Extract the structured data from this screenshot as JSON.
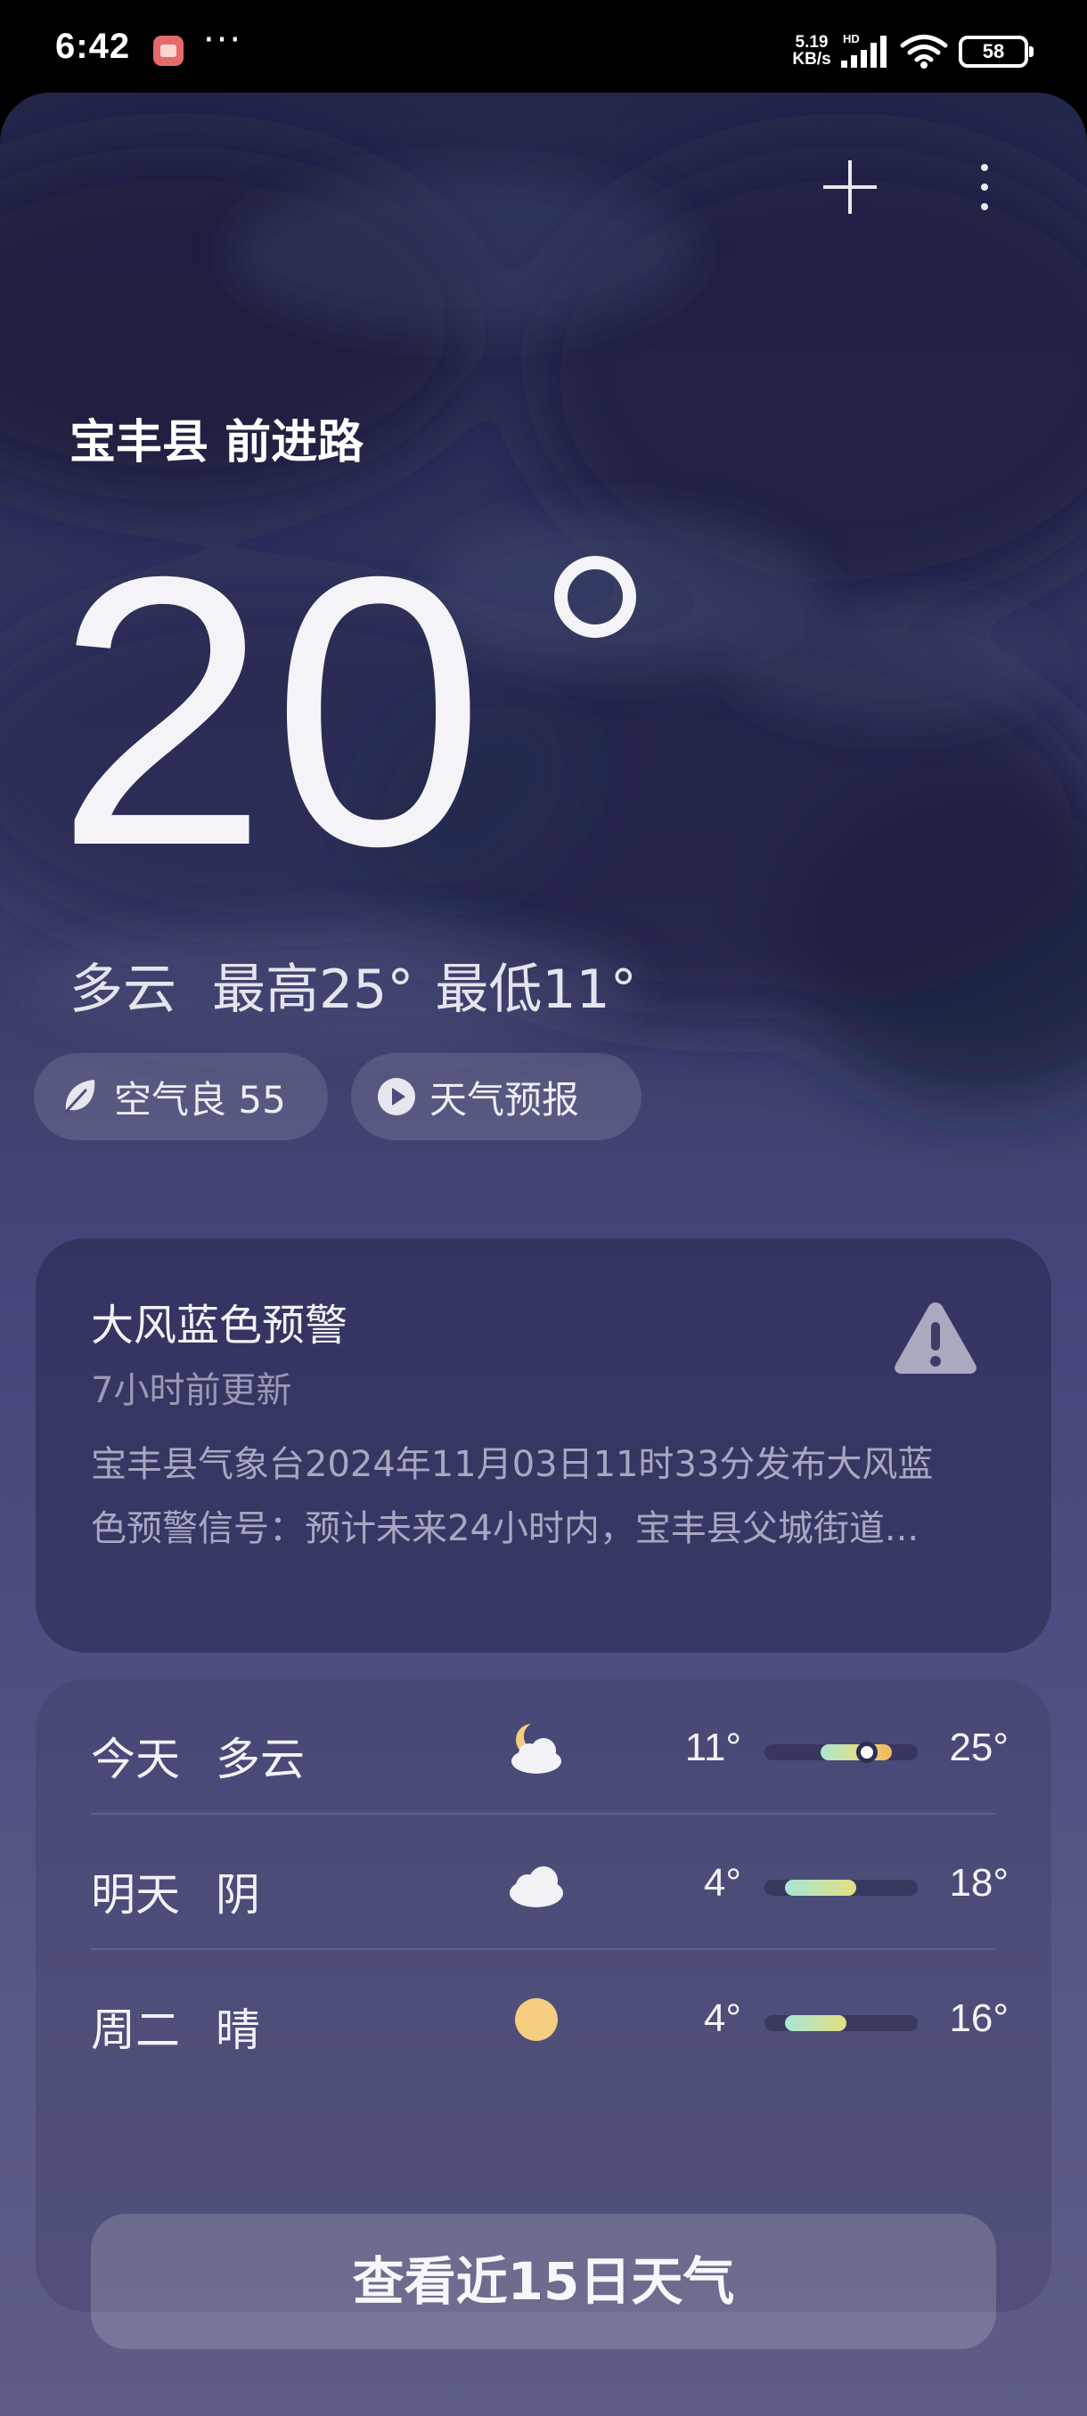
{
  "status_bar": {
    "time": "6:42",
    "net_speed_value": "5.19",
    "net_speed_unit": "KB/s",
    "network_label": "HD",
    "battery": "58"
  },
  "header": {
    "add_icon": "plus-icon",
    "more_icon": "more-vertical-icon"
  },
  "current": {
    "location": "宝丰县 前进路",
    "temperature": "20",
    "condition": "多云",
    "high": "最高25°",
    "low": "最低11°"
  },
  "pills": {
    "air_quality": "空气良 55",
    "forecast_video": "天气预报"
  },
  "warning": {
    "title": "大风蓝色预警",
    "updated": "7小时前更新",
    "line1": "宝丰县气象台2024年11月03日11时33分发布大风蓝",
    "line2": "色预警信号：预计未来24小时内，宝丰县父城街道...",
    "icon": "warning-triangle-icon"
  },
  "forecast": {
    "days": [
      {
        "day": "今天",
        "condition": "多云",
        "icon": "partly-cloudy-night-icon",
        "low": "11°",
        "high": "25°",
        "range": [
          11,
          25
        ],
        "current": 20
      },
      {
        "day": "明天",
        "condition": "阴",
        "icon": "cloud-icon",
        "low": "4°",
        "high": "18°",
        "range": [
          4,
          18
        ]
      },
      {
        "day": "周二",
        "condition": "晴",
        "icon": "sun-icon",
        "low": "4°",
        "high": "16°",
        "range": [
          4,
          16
        ]
      }
    ],
    "button_label": "查看近15日天气"
  },
  "colors": {
    "bar_cool": "#a8e6d4",
    "bar_mid": "#e4df82",
    "bar_warm": "#f3b25e"
  }
}
